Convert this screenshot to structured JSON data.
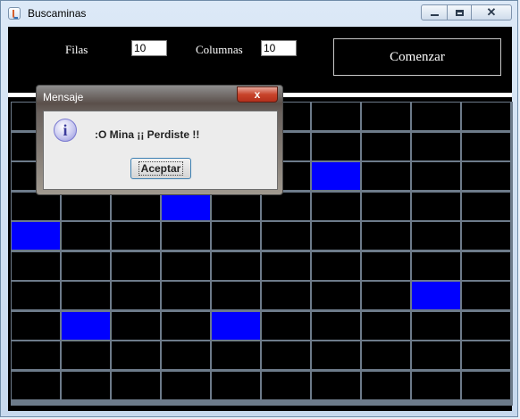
{
  "window": {
    "title": "Buscaminas",
    "controls": {
      "minimize_icon": "minimize-icon",
      "maximize_icon": "maximize-icon",
      "close_icon": "close-icon"
    }
  },
  "toolbar": {
    "rows_label": "Filas",
    "rows_value": "10",
    "cols_label": "Columnas",
    "cols_value": "10",
    "start_label": "Comenzar"
  },
  "board": {
    "rows": 10,
    "cols": 10,
    "cell_color": "#000000",
    "open_color": "#0000ff",
    "open_cells": [
      [
        2,
        6
      ],
      [
        3,
        3
      ],
      [
        4,
        0
      ],
      [
        6,
        8
      ],
      [
        7,
        1
      ],
      [
        7,
        4
      ]
    ]
  },
  "dialog": {
    "title": "Mensaje",
    "close_label": "x",
    "message": ":O Mina ¡¡ Perdiste !!",
    "icon": "information-icon",
    "ok_label": "Aceptar"
  }
}
